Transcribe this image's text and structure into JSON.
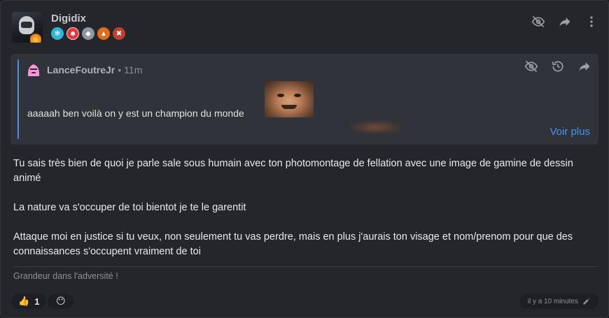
{
  "post": {
    "author": "Digidix",
    "badges": [
      {
        "name": "snowflake-badge-icon",
        "color": "#2fb6d6"
      },
      {
        "name": "clown-badge-icon",
        "color": "#e23a3a"
      },
      {
        "name": "shield-badge-icon",
        "color": "#8d98a6"
      },
      {
        "name": "flame-badge-icon",
        "color": "#e46a1e"
      },
      {
        "name": "skull-badge-icon",
        "color": "#b8432f"
      }
    ],
    "actions": [
      "hide-icon",
      "share-icon",
      "more-icon"
    ],
    "body": [
      "Tu sais très bien de quoi je parle sale sous humain avec ton photomontage de fellation avec une image de gamine de dessin animé",
      "La nature va s'occuper de toi bientot je te le garentit",
      "Attaque moi en justice si tu veux, non seulement tu vas perdre, mais en plus j'aurais ton visage et nom/prenom pour que des connaissances s'occupent vraiment de toi"
    ],
    "signature": "Grandeur dans l'adversité !",
    "reactions": [
      {
        "emoji": "👍",
        "count": "1"
      },
      {
        "emoji": "😶",
        "count": ""
      }
    ],
    "timestamp": "il y a 10 minutes"
  },
  "quote": {
    "author": "LanceFoutreJr",
    "separator": "•",
    "time": "11m",
    "text": "aaaaah ben voilà on y est un champion du monde",
    "more_label": "Voir plus",
    "actions": [
      "hide-icon",
      "history-icon",
      "share-icon"
    ]
  },
  "colors": {
    "accent": "#4a94ee",
    "card_bg": "#25262b",
    "quote_bg": "#31333a"
  }
}
